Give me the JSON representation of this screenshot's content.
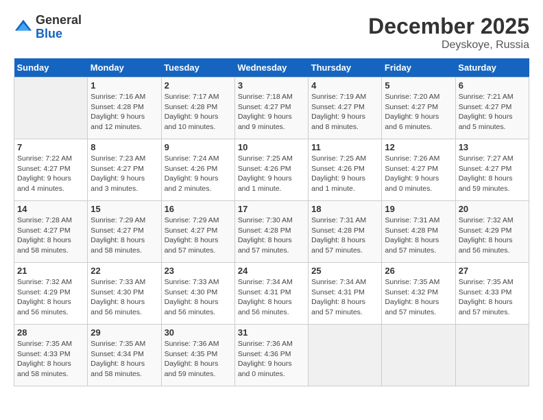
{
  "header": {
    "logo_general": "General",
    "logo_blue": "Blue",
    "month_title": "December 2025",
    "location": "Deyskoye, Russia"
  },
  "weekdays": [
    "Sunday",
    "Monday",
    "Tuesday",
    "Wednesday",
    "Thursday",
    "Friday",
    "Saturday"
  ],
  "weeks": [
    [
      {
        "day": "",
        "info": ""
      },
      {
        "day": "1",
        "info": "Sunrise: 7:16 AM\nSunset: 4:28 PM\nDaylight: 9 hours and 12 minutes."
      },
      {
        "day": "2",
        "info": "Sunrise: 7:17 AM\nSunset: 4:28 PM\nDaylight: 9 hours and 10 minutes."
      },
      {
        "day": "3",
        "info": "Sunrise: 7:18 AM\nSunset: 4:27 PM\nDaylight: 9 hours and 9 minutes."
      },
      {
        "day": "4",
        "info": "Sunrise: 7:19 AM\nSunset: 4:27 PM\nDaylight: 9 hours and 8 minutes."
      },
      {
        "day": "5",
        "info": "Sunrise: 7:20 AM\nSunset: 4:27 PM\nDaylight: 9 hours and 6 minutes."
      },
      {
        "day": "6",
        "info": "Sunrise: 7:21 AM\nSunset: 4:27 PM\nDaylight: 9 hours and 5 minutes."
      }
    ],
    [
      {
        "day": "7",
        "info": "Sunrise: 7:22 AM\nSunset: 4:27 PM\nDaylight: 9 hours and 4 minutes."
      },
      {
        "day": "8",
        "info": "Sunrise: 7:23 AM\nSunset: 4:27 PM\nDaylight: 9 hours and 3 minutes."
      },
      {
        "day": "9",
        "info": "Sunrise: 7:24 AM\nSunset: 4:26 PM\nDaylight: 9 hours and 2 minutes."
      },
      {
        "day": "10",
        "info": "Sunrise: 7:25 AM\nSunset: 4:26 PM\nDaylight: 9 hours and 1 minute."
      },
      {
        "day": "11",
        "info": "Sunrise: 7:25 AM\nSunset: 4:26 PM\nDaylight: 9 hours and 1 minute."
      },
      {
        "day": "12",
        "info": "Sunrise: 7:26 AM\nSunset: 4:27 PM\nDaylight: 9 hours and 0 minutes."
      },
      {
        "day": "13",
        "info": "Sunrise: 7:27 AM\nSunset: 4:27 PM\nDaylight: 8 hours and 59 minutes."
      }
    ],
    [
      {
        "day": "14",
        "info": "Sunrise: 7:28 AM\nSunset: 4:27 PM\nDaylight: 8 hours and 58 minutes."
      },
      {
        "day": "15",
        "info": "Sunrise: 7:29 AM\nSunset: 4:27 PM\nDaylight: 8 hours and 58 minutes."
      },
      {
        "day": "16",
        "info": "Sunrise: 7:29 AM\nSunset: 4:27 PM\nDaylight: 8 hours and 57 minutes."
      },
      {
        "day": "17",
        "info": "Sunrise: 7:30 AM\nSunset: 4:28 PM\nDaylight: 8 hours and 57 minutes."
      },
      {
        "day": "18",
        "info": "Sunrise: 7:31 AM\nSunset: 4:28 PM\nDaylight: 8 hours and 57 minutes."
      },
      {
        "day": "19",
        "info": "Sunrise: 7:31 AM\nSunset: 4:28 PM\nDaylight: 8 hours and 57 minutes."
      },
      {
        "day": "20",
        "info": "Sunrise: 7:32 AM\nSunset: 4:29 PM\nDaylight: 8 hours and 56 minutes."
      }
    ],
    [
      {
        "day": "21",
        "info": "Sunrise: 7:32 AM\nSunset: 4:29 PM\nDaylight: 8 hours and 56 minutes."
      },
      {
        "day": "22",
        "info": "Sunrise: 7:33 AM\nSunset: 4:30 PM\nDaylight: 8 hours and 56 minutes."
      },
      {
        "day": "23",
        "info": "Sunrise: 7:33 AM\nSunset: 4:30 PM\nDaylight: 8 hours and 56 minutes."
      },
      {
        "day": "24",
        "info": "Sunrise: 7:34 AM\nSunset: 4:31 PM\nDaylight: 8 hours and 56 minutes."
      },
      {
        "day": "25",
        "info": "Sunrise: 7:34 AM\nSunset: 4:31 PM\nDaylight: 8 hours and 57 minutes."
      },
      {
        "day": "26",
        "info": "Sunrise: 7:35 AM\nSunset: 4:32 PM\nDaylight: 8 hours and 57 minutes."
      },
      {
        "day": "27",
        "info": "Sunrise: 7:35 AM\nSunset: 4:33 PM\nDaylight: 8 hours and 57 minutes."
      }
    ],
    [
      {
        "day": "28",
        "info": "Sunrise: 7:35 AM\nSunset: 4:33 PM\nDaylight: 8 hours and 58 minutes."
      },
      {
        "day": "29",
        "info": "Sunrise: 7:35 AM\nSunset: 4:34 PM\nDaylight: 8 hours and 58 minutes."
      },
      {
        "day": "30",
        "info": "Sunrise: 7:36 AM\nSunset: 4:35 PM\nDaylight: 8 hours and 59 minutes."
      },
      {
        "day": "31",
        "info": "Sunrise: 7:36 AM\nSunset: 4:36 PM\nDaylight: 9 hours and 0 minutes."
      },
      {
        "day": "",
        "info": ""
      },
      {
        "day": "",
        "info": ""
      },
      {
        "day": "",
        "info": ""
      }
    ]
  ]
}
